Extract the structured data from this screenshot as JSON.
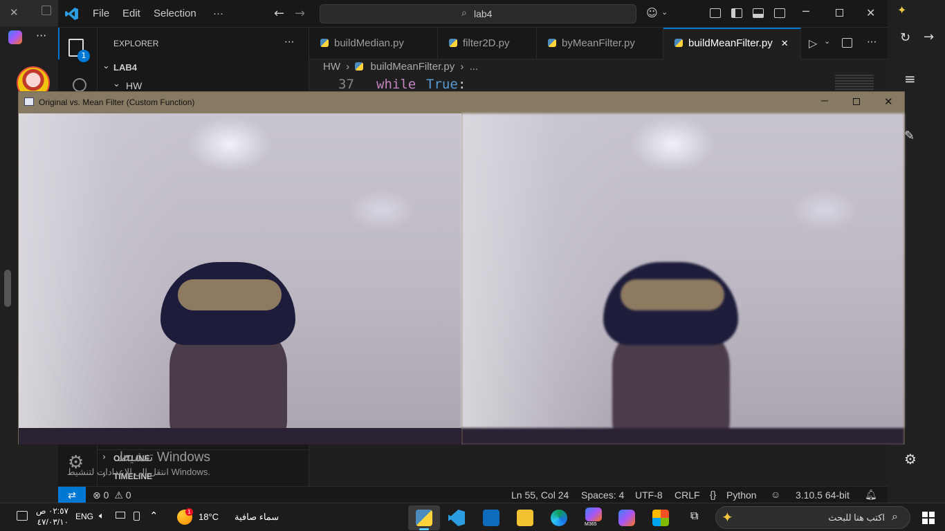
{
  "vscode": {
    "menu": [
      "File",
      "Edit",
      "Selection",
      "···"
    ],
    "command_center": "lab4",
    "explorer_title": "EXPLORER",
    "explorer_more": "···",
    "root_folder": "LAB4",
    "sub_folder": "HW",
    "badge_count": "1",
    "outline_label": "OUTLINE",
    "timeline_label": "TIMELINE",
    "tabs": [
      {
        "label": "buildMedian.py"
      },
      {
        "label": "filter2D.py"
      },
      {
        "label": "byMeanFilter.py"
      },
      {
        "label": "buildMeanFilter.py",
        "close": "✕"
      }
    ],
    "breadcrumb": {
      "folder": "HW",
      "file": "buildMeanFilter.py",
      "rest": "..."
    },
    "code": {
      "line_number": "37",
      "keyword": "while",
      "value": "True",
      "colon": ":"
    },
    "status": {
      "errors": "0",
      "warnings": "0",
      "position": "Ln 55, Col 24",
      "spaces": "Spaces: 4",
      "encoding": "UTF-8",
      "eol": "CRLF",
      "language": "Python",
      "interpreter": "3.10.5 64-bit"
    }
  },
  "cv_window": {
    "title": "Original vs. Mean Filter (Custom Function)"
  },
  "activation": {
    "line1": "تنشيط Windows",
    "line2": "انتقل إلى الإعدادات لتنشيط Windows."
  },
  "taskbar": {
    "time": "٠٢:٥٧ ص",
    "date": "٤٧/٠٣/١٠",
    "lang": "ENG",
    "temperature": "18°C",
    "weather": "سماء صافية",
    "search_placeholder": "اكتب هنا للبحث",
    "weather_badge": "1",
    "m365_label": "M365"
  },
  "colors": {
    "accent": "#0078d4",
    "cv_titlebar": "#877a62"
  }
}
